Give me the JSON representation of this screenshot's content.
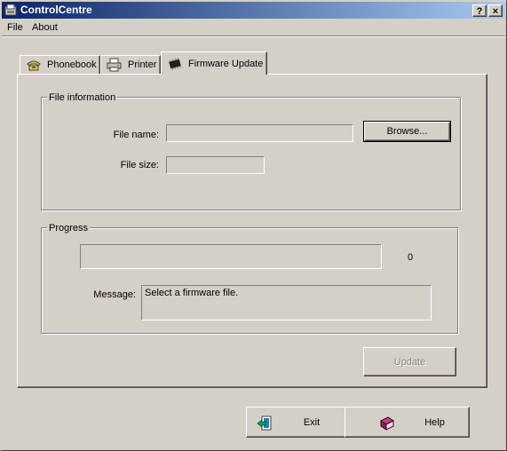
{
  "window": {
    "title": "ControlCentre"
  },
  "title_buttons": {
    "help": "?",
    "close": "×"
  },
  "menu": {
    "items": [
      {
        "label": "File"
      },
      {
        "label": "About"
      }
    ]
  },
  "tabs": [
    {
      "label": "Phonebook",
      "icon": "phone-icon"
    },
    {
      "label": "Printer",
      "icon": "printer-icon"
    },
    {
      "label": "Firmware Update",
      "icon": "chip-icon",
      "active": true
    }
  ],
  "file_info": {
    "legend": "File information",
    "file_name_label": "File name:",
    "file_name_value": "",
    "file_size_label": "File size:",
    "file_size_value": "",
    "browse_label": "Browse..."
  },
  "progress": {
    "legend": "Progress",
    "value": 0,
    "value_text": "0",
    "message_label": "Message:",
    "message_text": "Select a firmware file."
  },
  "buttons": {
    "update": "Update",
    "exit": "Exit",
    "help": "Help"
  }
}
